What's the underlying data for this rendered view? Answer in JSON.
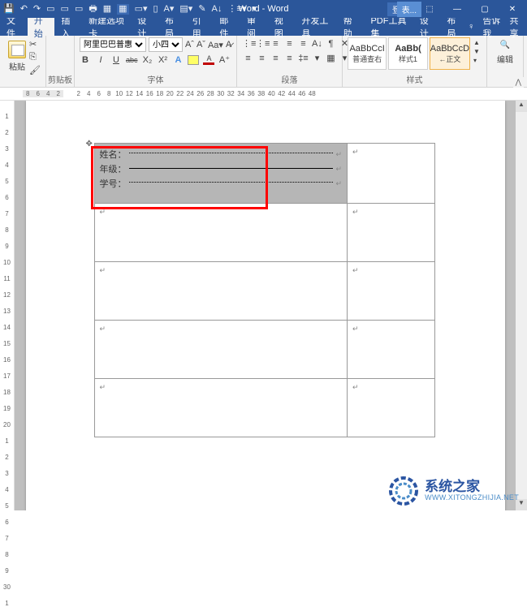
{
  "titlebar": {
    "title": "Word - Word",
    "context": "表...",
    "login": "登录",
    "qat_icons": [
      "save-icon",
      "undo-icon",
      "redo-icon",
      "new-icon",
      "open-icon",
      "save2-icon",
      "print-icon",
      "preview-icon",
      "mode-icon",
      "more1-icon",
      "more2-icon",
      "a1-icon",
      "a2-icon",
      "a3-icon",
      "ruler-icon",
      "list-icon",
      "grid-icon",
      "dd-icon"
    ]
  },
  "tabs": {
    "items": [
      "文件",
      "开始",
      "插入",
      "新建选项卡",
      "设计",
      "布局",
      "引用",
      "邮件",
      "审阅",
      "视图",
      "开发工具",
      "帮助",
      "PDF工具集",
      "设计",
      "布局"
    ],
    "active_index": 1,
    "tell_me": "告诉我",
    "share": "共享"
  },
  "ribbon": {
    "clipboard": {
      "paste": "粘贴",
      "label": "剪贴板"
    },
    "font": {
      "family": "阿里巴巴普惠",
      "size": "小四",
      "label": "字体",
      "buttons": {
        "bold": "B",
        "italic": "I",
        "underline": "U",
        "abc": "abc",
        "x2": "X₂",
        "x2s": "X²",
        "a_letter": "A"
      }
    },
    "paragraph": {
      "label": "段落"
    },
    "styles": {
      "label": "样式",
      "items": [
        {
          "preview": "AaBbCcI",
          "name": "普通查右"
        },
        {
          "preview": "AaBb(",
          "name": "样式1"
        },
        {
          "preview": "AaBbCcD",
          "name": "←正文"
        }
      ]
    },
    "editing": {
      "label": "编辑"
    }
  },
  "ruler": {
    "h": [
      "8",
      "6",
      "4",
      "2",
      "",
      "2",
      "4",
      "6",
      "8",
      "10",
      "12",
      "14",
      "16",
      "18",
      "20",
      "22",
      "24",
      "26",
      "28",
      "30",
      "32",
      "34",
      "36",
      "38",
      "40",
      "42",
      "44",
      "46",
      "48"
    ],
    "v": [
      "",
      "1",
      "2",
      "3",
      "4",
      "5",
      "6",
      "7",
      "8",
      "9",
      "10",
      "11",
      "12",
      "13",
      "14",
      "15",
      "16",
      "17",
      "18",
      "19",
      "20",
      "1",
      "2",
      "3",
      "4",
      "5",
      "6",
      "7",
      "8",
      "9",
      "30",
      "1"
    ]
  },
  "document": {
    "form": {
      "rows": [
        {
          "label": "姓名：",
          "style": "dots"
        },
        {
          "label": "年级：",
          "style": "solid"
        },
        {
          "label": "学号：",
          "style": "dots"
        }
      ]
    }
  },
  "watermark": {
    "name": "系统之家",
    "url": "WWW.XITONGZHIJIA.NET"
  }
}
